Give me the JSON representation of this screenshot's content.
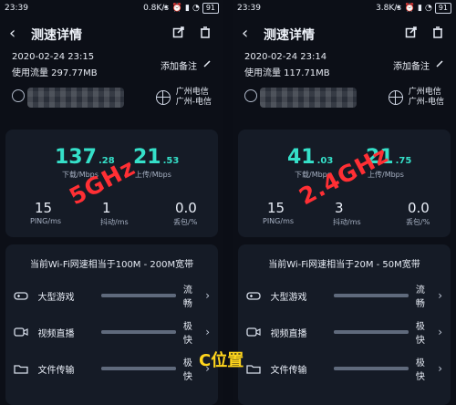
{
  "left_panel": {
    "status_bar": {
      "time": "23:39",
      "speed": "0.8K/s",
      "battery": "91"
    },
    "header": {
      "title": "测速详情"
    },
    "meta": {
      "date": "2020-02-24 23:15",
      "used_traffic": "使用流量 297.77MB",
      "add_note": "添加备注"
    },
    "isp": {
      "line1": "广州电信",
      "line2": "广州-电信"
    },
    "speeds": {
      "download_int": "137",
      "download_dec": ".28",
      "download_label": "下载/Mbps",
      "upload_int": "21",
      "upload_dec": ".53",
      "upload_label": "上传/Mbps"
    },
    "metrics": {
      "ping_value": "15",
      "ping_label": "PING/ms",
      "jitter_value": "1",
      "jitter_label": "抖动/ms",
      "loss_value": "0.0",
      "loss_label": "丢包/%"
    },
    "overlay_label": "5GHz",
    "wifi_equivalent": "当前Wi-Fi网速相当于100M - 200M宽带",
    "rows": [
      {
        "name": "大型游戏",
        "status": "流畅",
        "level": 1.0
      },
      {
        "name": "视频直播",
        "status": "极快",
        "level": 1.0
      },
      {
        "name": "文件传输",
        "status": "极快",
        "level": 1.0
      }
    ]
  },
  "right_panel": {
    "status_bar": {
      "time": "23:39",
      "speed": "3.8K/s",
      "battery": "91"
    },
    "header": {
      "title": "测速详情"
    },
    "meta": {
      "date": "2020-02-24 23:14",
      "used_traffic": "使用流量 117.71MB",
      "add_note": "添加备注"
    },
    "isp": {
      "line1": "广州电信",
      "line2": "广州-电信"
    },
    "speeds": {
      "download_int": "41",
      "download_dec": ".03",
      "download_label": "下载/Mbps",
      "upload_int": "21",
      "upload_dec": ".75",
      "upload_label": "上传/Mbps"
    },
    "metrics": {
      "ping_value": "15",
      "ping_label": "PING/ms",
      "jitter_value": "3",
      "jitter_label": "抖动/ms",
      "loss_value": "0.0",
      "loss_label": "丢包/%"
    },
    "overlay_label": "2.4GHz",
    "wifi_equivalent": "当前Wi-Fi网速相当于20M - 50M宽带",
    "rows": [
      {
        "name": "大型游戏",
        "status": "流畅",
        "level": 1.0
      },
      {
        "name": "视频直播",
        "status": "极快",
        "level": 1.0
      },
      {
        "name": "文件传输",
        "status": "极快",
        "level": 1.0
      }
    ]
  },
  "caption": "C位置",
  "icons": {
    "back": "chevron-left-icon",
    "share": "share-icon",
    "trash": "trash-icon",
    "edit": "pencil-icon",
    "globe": "globe-icon",
    "game": "gamepad-icon",
    "video": "video-icon",
    "folder": "folder-icon",
    "chevron": "chevron-right-icon"
  }
}
